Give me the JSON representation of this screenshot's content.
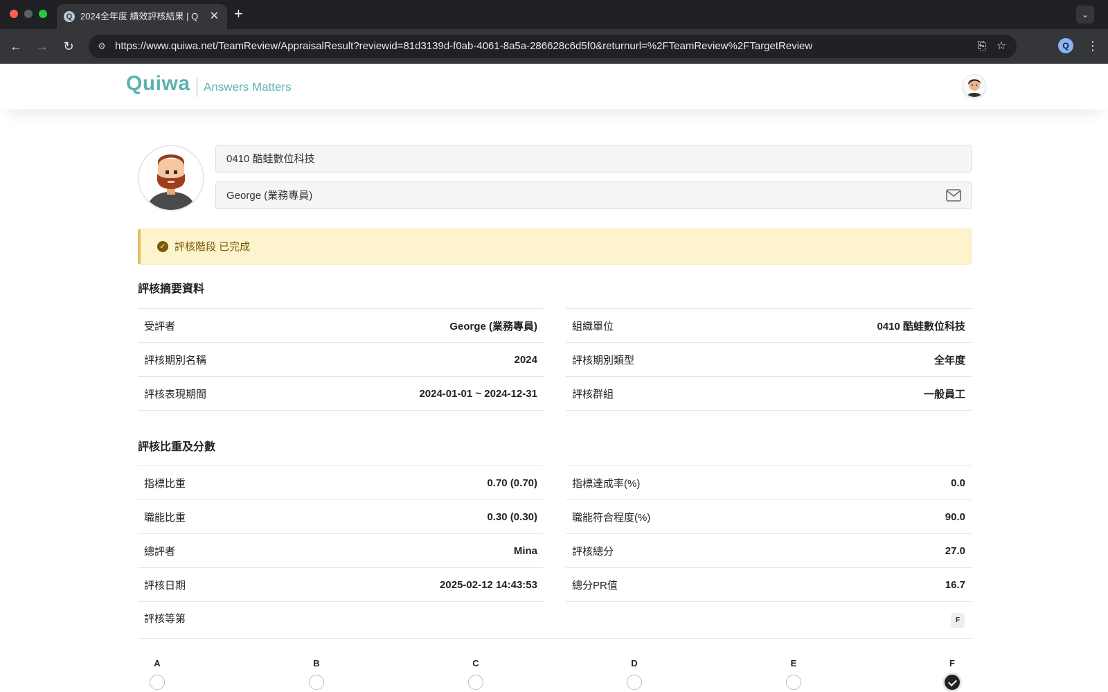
{
  "browser": {
    "tab_title": "2024全年度 績效評核結果 | Quiwa",
    "favicon_letter": "Q",
    "url": "https://www.quiwa.net/TeamReview/AppraisalResult?reviewid=81d3139d-f0ab-4061-8a5a-286628c6d5f0&returnurl=%2FTeamReview%2FTargetReview",
    "icons": {
      "back": "arrow-left-icon",
      "forward": "arrow-right-icon",
      "reload": "reload-icon",
      "site_info": "tune-icon",
      "install": "install-app-icon",
      "bookmark": "star-icon",
      "menu": "kebab-icon"
    }
  },
  "header": {
    "logo": "Quiwa",
    "tagline": "Answers Matters"
  },
  "profile": {
    "organization": "0410 酷蛙數位科技",
    "name": "George (業務專員)",
    "mail_icon": "envelope-icon"
  },
  "status_alert": {
    "text": "評核階段 已完成",
    "icon": "check-circle-icon",
    "colors": {
      "background": "#fdf3cd",
      "border": "#e2bd5a",
      "text": "#7a5a0a"
    }
  },
  "summary": {
    "title": "評核摘要資料",
    "left": [
      {
        "key": "受評者",
        "value": "George (業務專員)"
      },
      {
        "key": "評核期別名稱",
        "value": "2024"
      },
      {
        "key": "評核表現期間",
        "value": "2024-01-01 ~ 2024-12-31"
      }
    ],
    "right": [
      {
        "key": "組織單位",
        "value": "0410 酷蛙數位科技"
      },
      {
        "key": "評核期別類型",
        "value": "全年度"
      },
      {
        "key": "評核群組",
        "value": "一般員工"
      }
    ]
  },
  "scores": {
    "title": "評核比重及分數",
    "left": [
      {
        "key": "指標比重",
        "value": "0.70 (0.70)"
      },
      {
        "key": "職能比重",
        "value": "0.30 (0.30)"
      },
      {
        "key": "總評者",
        "value": "Mina"
      },
      {
        "key": "評核日期",
        "value": "2025-02-12 14:43:53"
      }
    ],
    "right": [
      {
        "key": "指標達成率(%)",
        "value": "0.0"
      },
      {
        "key": "職能符合程度(%)",
        "value": "90.0"
      },
      {
        "key": "評核總分",
        "value": "27.0"
      },
      {
        "key": "總分PR值",
        "value": "16.7"
      }
    ],
    "grade_label": "評核等第",
    "grade_value": "F"
  },
  "grade_scale": {
    "options": [
      "A",
      "B",
      "C",
      "D",
      "E",
      "F"
    ],
    "selected": "F"
  },
  "theme": {
    "brand": "#5bb3b0",
    "browser_dark": "#202124",
    "browser_toolbar": "#35363a"
  }
}
